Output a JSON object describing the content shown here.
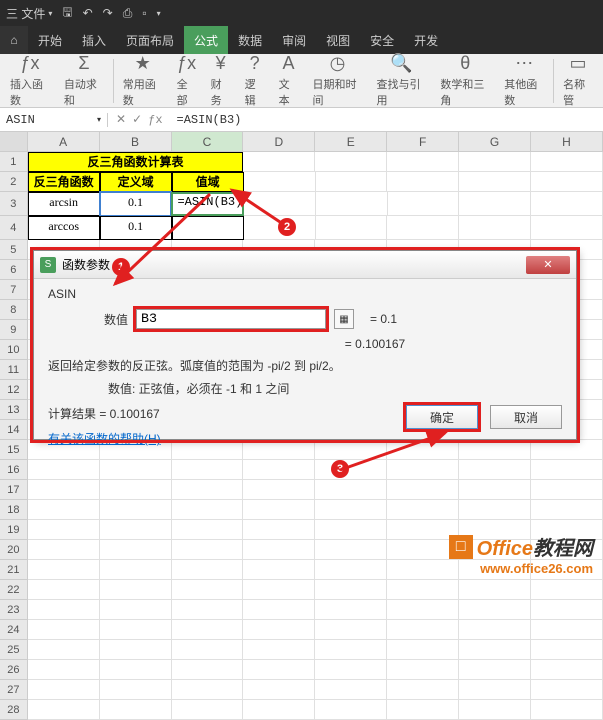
{
  "topbar": {
    "menu_label": "三 文件",
    "icons": [
      "save",
      "undo",
      "redo",
      "print",
      "preview"
    ]
  },
  "tabs": [
    "开始",
    "插入",
    "页面布局",
    "公式",
    "数据",
    "审阅",
    "视图",
    "安全",
    "开发"
  ],
  "active_tab": "公式",
  "ribbon": {
    "insert_fn": "插入函数",
    "autosum": "自动求和",
    "common": "常用函数",
    "all": "全部",
    "finance": "财务",
    "logic": "逻辑",
    "text": "文本",
    "datetime": "日期和时间",
    "lookup": "查找与引用",
    "math": "数学和三角",
    "other": "其他函数",
    "name_mgr": "名称管"
  },
  "namebox": "ASIN",
  "formula": "=ASIN(B3)",
  "columns": [
    "A",
    "B",
    "C",
    "D",
    "E",
    "F",
    "G",
    "H"
  ],
  "table": {
    "title": "反三角函数计算表",
    "h1": "反三角函数",
    "h2": "定义域",
    "h3": "值域",
    "r1c1": "arcsin",
    "r1c2": "0.1",
    "r1c3": "=ASIN(B3)",
    "r2c1": "arccos",
    "r2c2": "0.1"
  },
  "dialog": {
    "title": "函数参数",
    "fn": "ASIN",
    "param_label": "数值",
    "param_value": "B3",
    "param_result": "= 0.1",
    "formula_result": "= 0.100167",
    "desc": "返回给定参数的反正弦。弧度值的范围为 -pi/2 到 pi/2。",
    "desc_sub": "数值: 正弦值，必须在 -1 和 1 之间",
    "calc_label": "计算结果 = 0.100167",
    "help": "有关该函数的帮助(H)",
    "ok": "确定",
    "cancel": "取消"
  },
  "annotations": {
    "a1": "1",
    "a2": "2",
    "a3": "3"
  },
  "watermark": {
    "brand": "Office",
    "brand2": "教程网",
    "url": "www.office26.com"
  }
}
